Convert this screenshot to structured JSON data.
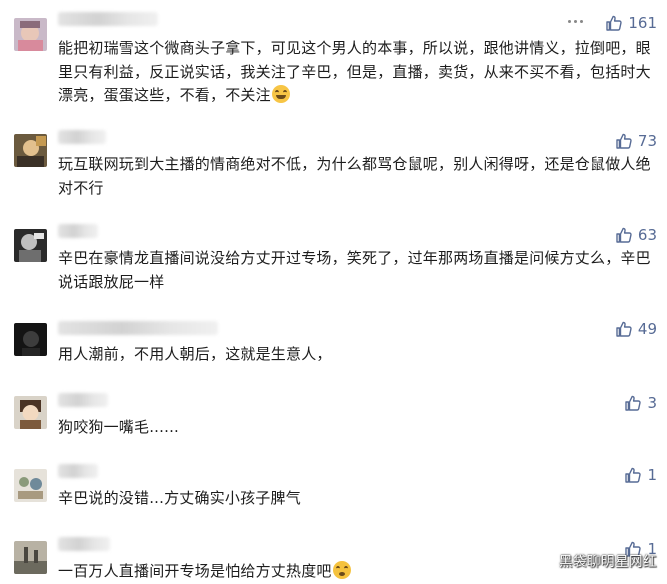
{
  "comments": [
    {
      "text": "能把初瑞雪这个微商头子拿下，可见这个男人的本事，所以说，跟他讲情义，拉倒吧，眼里只有利益，反正说实话，我关注了辛巴，但是，直播，卖货，从来不买不看，包括时大漂亮，蛋蛋这些，不看，不关注",
      "likes": "161",
      "emoji": "grinning-face-emoji"
    },
    {
      "text": "玩互联网玩到大主播的情商绝对不低，为什么都骂仓鼠呢，别人闲得呀，还是仓鼠做人绝对不行",
      "likes": "73"
    },
    {
      "text": "辛巴在豪情龙直播间说没给方丈开过专场，笑死了，过年那两场直播是问候方丈么，辛巴说话跟放屁一样",
      "likes": "63"
    },
    {
      "text": "用人潮前，不用人朝后，这就是生意人，",
      "likes": "49"
    },
    {
      "text": "狗咬狗一嘴毛......",
      "likes": "3"
    },
    {
      "text": "辛巴说的没错...方丈确实小孩子脾气",
      "likes": "1"
    },
    {
      "text": "一百万人直播间开专场是怕给方丈热度吧",
      "likes": "1",
      "emoji": "flushed-face-emoji"
    }
  ],
  "watermark": "黑袋聊明星网红",
  "icons": {
    "like": "thumbs-up-icon",
    "more": "more-dots-icon"
  },
  "colors": {
    "like": "#576b95",
    "text": "#1d1d1d"
  }
}
